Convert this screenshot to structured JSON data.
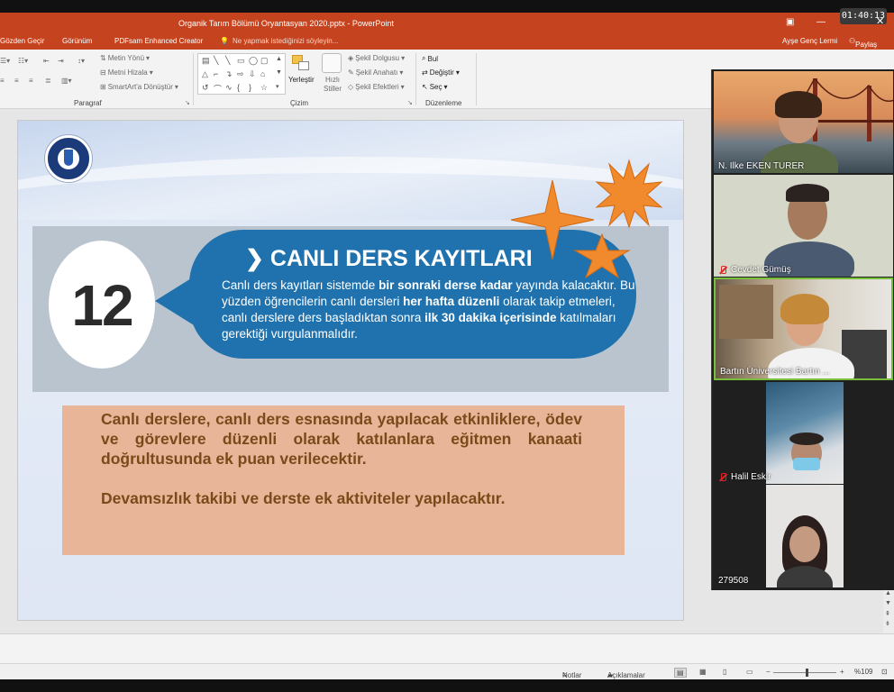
{
  "window": {
    "title": "Organik Tarım Bölümü Oryantasyan 2020.pptx  -  PowerPoint",
    "clock": "01:40:13"
  },
  "tabs": {
    "review": "Gözden Geçir",
    "view": "Görünüm",
    "pdfsam": "PDFsam Enhanced Creator",
    "tellme": "Ne yapmak istediğinizi söyleyin...",
    "user": "Ayşe Genç Lermi",
    "share": "Paylaş"
  },
  "ribbon": {
    "paragraph_group": "Paragraf",
    "text_direction": "Metin Yönü",
    "align_text": "Metni Hizala",
    "smartart": "SmartArt'a Dönüştür",
    "drawing_group": "Çizim",
    "arrange": "Yerleştir",
    "quick_styles": "Hızlı Stiller",
    "shape_fill": "Şekil Dolgusu",
    "shape_outline": "Şekil Anahatı",
    "shape_effects": "Şekil Efektleri",
    "editing_group": "Düzenleme",
    "find": "Bul",
    "replace": "Değiştir",
    "select": "Seç"
  },
  "slide": {
    "number": "12",
    "heading_arrow": "❯",
    "heading": "CANLI DERS KAYITLARI",
    "body_parts": [
      "Canlı ders kayıtları sistemde ",
      "bir sonraki derse kadar",
      " yayında kalacaktır. Bu yüzden öğrencilerin canlı dersleri ",
      "her hafta düzenli",
      " olarak takip etmeleri, canlı derslere ders başladıktan sonra ",
      "ilk 30 dakika içerisinde",
      " katılmaları gerektiği vurgulanmalıdır."
    ],
    "orange_p1": "Canlı derslere, canlı ders esnasında yapılacak etkinliklere, ödev ve görevlere düzenli olarak katılanlara eğitmen kanaati doğrultusunda ek puan verilecektir.",
    "orange_p2": "Devamsızlık takibi ve derste ek aktiviteler yapılacaktır."
  },
  "status": {
    "notes": "Notlar",
    "comments": "Açıklamalar",
    "zoom": "%109"
  },
  "participants": [
    {
      "name": "N. Ilke EKEN TURER",
      "muted": false
    },
    {
      "name": "Cevdet Gümüş",
      "muted": true
    },
    {
      "name": "Bartın Üniversitesi Bartın ...",
      "muted": false
    },
    {
      "name": "Halil Eskir",
      "muted": true
    },
    {
      "name": "279508",
      "muted": false
    }
  ],
  "colors": {
    "titlebar": "#c5441f",
    "bubble": "#1f72ad",
    "orange_box": "#e9b598",
    "orange_text": "#7a4a1a",
    "star": "#f08a2c"
  }
}
